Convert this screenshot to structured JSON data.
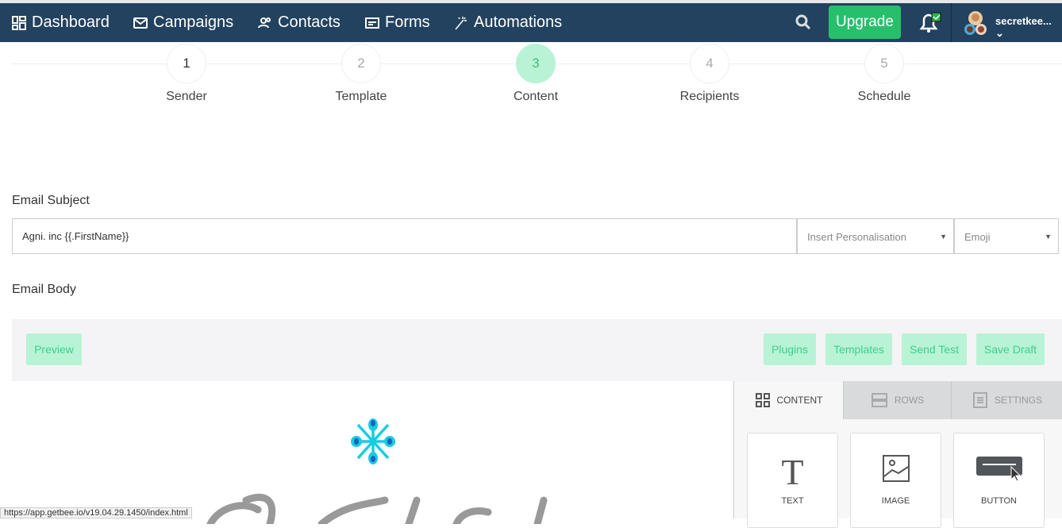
{
  "nav": {
    "items": [
      {
        "label": "Dashboard",
        "icon": "dashboard-icon"
      },
      {
        "label": "Campaigns",
        "icon": "envelope-icon"
      },
      {
        "label": "Contacts",
        "icon": "contacts-icon"
      },
      {
        "label": "Forms",
        "icon": "form-icon"
      },
      {
        "label": "Automations",
        "icon": "magic-wand-icon"
      }
    ],
    "upgrade": "Upgrade",
    "username": "secretkee...",
    "colors": {
      "bar": "#22425f",
      "upgrade": "#28bf6c"
    }
  },
  "steps": [
    {
      "num": "1",
      "label": "Sender"
    },
    {
      "num": "2",
      "label": "Template"
    },
    {
      "num": "3",
      "label": "Content"
    },
    {
      "num": "4",
      "label": "Recipients"
    },
    {
      "num": "5",
      "label": "Schedule"
    }
  ],
  "active_step": 3,
  "subject": {
    "label": "Email Subject",
    "value": "Agni. inc {{.FirstName}}",
    "personalisation": "Insert Personalisation",
    "emoji": "Emoji"
  },
  "body": {
    "label": "Email Body",
    "preview": "Preview",
    "plugins": "Plugins",
    "templates": "Templates",
    "send_test": "Send Test",
    "save_draft": "Save Draft"
  },
  "panel": {
    "tabs": [
      "CONTENT",
      "ROWS",
      "SETTINGS"
    ],
    "blocks": [
      "TEXT",
      "IMAGE",
      "BUTTON"
    ]
  },
  "status_url": "https://app.getbee.io/v19.04.29.1450/index.html"
}
